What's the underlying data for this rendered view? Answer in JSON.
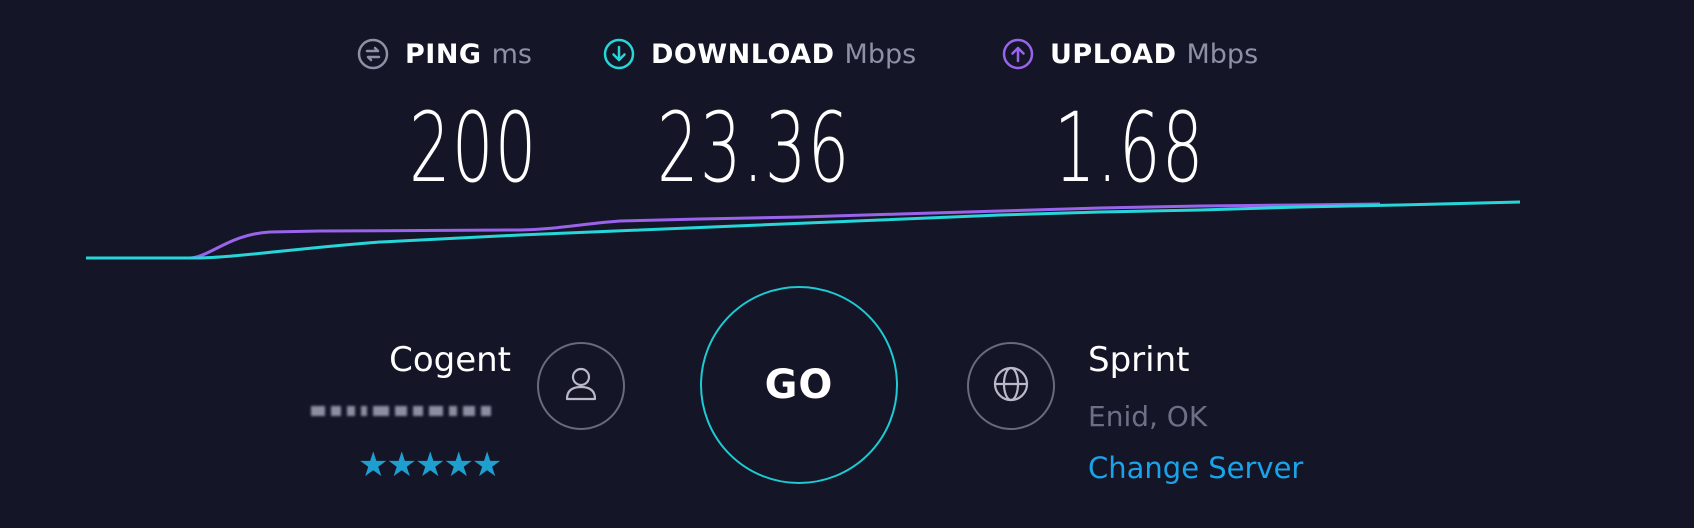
{
  "metrics": {
    "ping": {
      "label": "PING",
      "unit": "ms",
      "value": "200",
      "icon": "ping-icon"
    },
    "download": {
      "label": "DOWNLOAD",
      "unit": "Mbps",
      "value": "23.36",
      "icon": "download-arrow-icon"
    },
    "upload": {
      "label": "UPLOAD",
      "unit": "Mbps",
      "value": "1.68",
      "icon": "upload-arrow-icon"
    }
  },
  "colors": {
    "background": "#141526",
    "download": "#26d6d8",
    "upload": "#9a63ec",
    "ping_icon": "#8f8fa6",
    "go_ring": "#1ecad3",
    "link": "#1aa3ea",
    "stars": "#1e9fd0"
  },
  "isp": {
    "name": "Cogent",
    "ip": "",
    "rating": "★★★★★",
    "icon": "user-icon"
  },
  "go_button": {
    "label": "GO"
  },
  "server": {
    "name": "Sprint",
    "location": "Enid, OK",
    "change_label": "Change Server",
    "icon": "globe-icon"
  }
}
